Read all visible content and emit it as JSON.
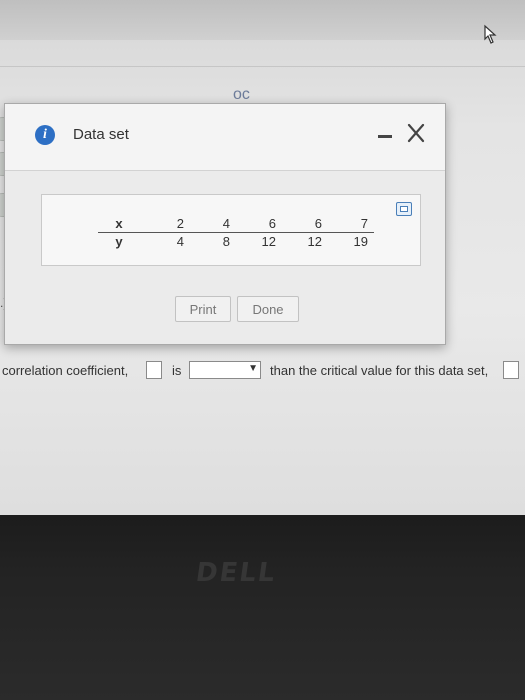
{
  "dialog": {
    "title": "Data set",
    "print_label": "Print",
    "done_label": "Done"
  },
  "data_table": {
    "rows": [
      {
        "label": "x",
        "values": [
          "2",
          "4",
          "6",
          "6",
          "7"
        ]
      },
      {
        "label": "y",
        "values": [
          "4",
          "8",
          "12",
          "12",
          "19"
        ]
      }
    ]
  },
  "question": {
    "part1": "correlation coefficient,",
    "part2": "is",
    "part3": "than the critical value for this data set,"
  },
  "background": {
    "top_fragment": "oc",
    "left_fragment": ".)",
    "monitor_brand": "DELL"
  },
  "colors": {
    "info_icon": "#2d6fc4",
    "dialog_bg": "#ebebeb"
  }
}
